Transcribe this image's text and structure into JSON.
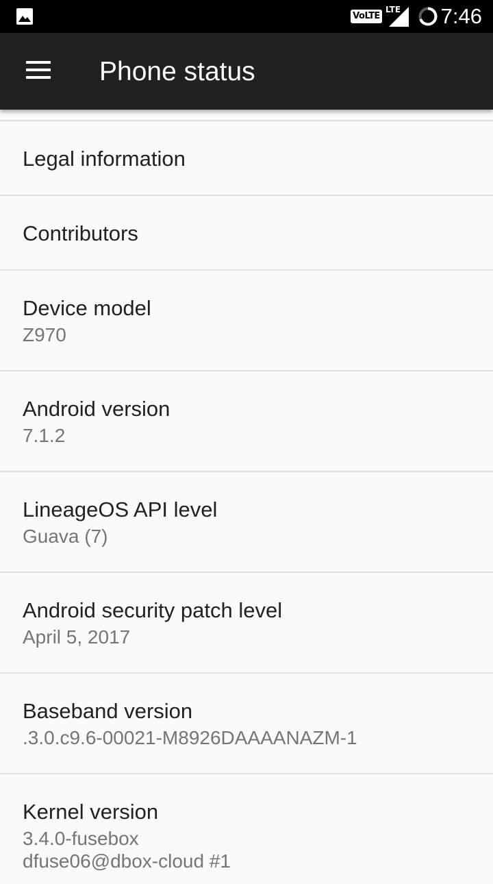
{
  "status_bar": {
    "notification_icon": "gallery-icon",
    "volte_label": "VoLTE",
    "network_label": "LTE",
    "signal_icon": "cell-signal-icon",
    "battery_icon": "battery-circle-icon",
    "time": "7:46"
  },
  "app_bar": {
    "menu_icon": "hamburger-menu-icon",
    "title": "Phone status"
  },
  "items": [
    {
      "title": "Legal information"
    },
    {
      "title": "Contributors"
    },
    {
      "title": "Device model",
      "subtitle": "Z970"
    },
    {
      "title": "Android version",
      "subtitle": "7.1.2"
    },
    {
      "title": "LineageOS API level",
      "subtitle": "Guava (7)"
    },
    {
      "title": "Android security patch level",
      "subtitle": "April 5, 2017"
    },
    {
      "title": "Baseband version",
      "subtitle": ".3.0.c9.6-00021-M8926DAAAANAZM-1"
    },
    {
      "title": "Kernel version",
      "subtitle": "3.4.0-fusebox\ndfuse06@dbox-cloud #1"
    }
  ],
  "colors": {
    "status_bar_bg": "#000000",
    "app_bar_bg": "#212121",
    "list_bg": "#fafafa",
    "title_text": "#212121",
    "subtitle_text": "#757575",
    "divider": "#e0e0e0"
  }
}
